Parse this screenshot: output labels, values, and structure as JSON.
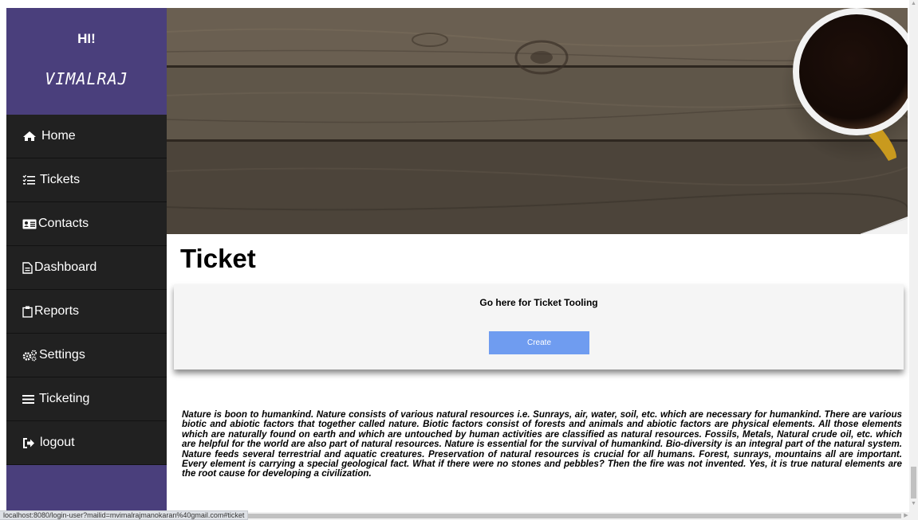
{
  "sidebar": {
    "greeting": "HI!",
    "user_name": "VIMALRAJ",
    "items": [
      {
        "label": "Home",
        "icon": "home-icon"
      },
      {
        "label": "Tickets",
        "icon": "list-check-icon"
      },
      {
        "label": "Contacts",
        "icon": "address-card-icon"
      },
      {
        "label": "Dashboard",
        "icon": "file-icon"
      },
      {
        "label": "Reports",
        "icon": "clipboard-icon"
      },
      {
        "label": "Settings",
        "icon": "gears-icon"
      },
      {
        "label": "Ticketing",
        "icon": "bars-icon"
      },
      {
        "label": "logout",
        "icon": "sign-out-icon"
      }
    ]
  },
  "main": {
    "title": "Ticket",
    "card": {
      "heading": "Go here for Ticket Tooling",
      "button_label": "Create"
    },
    "paragraph": "Nature is boon to humankind. Nature consists of various natural resources i.e. Sunrays, air, water, soil, etc. which are necessary for humankind. There are various biotic and abiotic factors that together called nature. Biotic factors consist of forests and animals and abiotic factors are physical elements. All those elements which are naturally found on earth and which are untouched by human activities are classified as natural resources. Fossils, Metals, Natural crude oil, etc. which are helpful for the world are also part of natural resources. Nature is essential for the survival of humankind. Bio-diversity is an integral part of the natural system. Nature feeds several terrestrial and aquatic creatures. Preservation of natural resources is crucial for all humans. Forest, sunrays, mountains all are important. Every element is carrying a special geological fact. What if there were no stones and pebbles? Then the fire was not invented. Yes, it is true natural elements are the root cause for developing a civilization."
  },
  "status_bar": {
    "url": "localhost:8080/login-user?mailid=mvimalrajmanokaran%40gmail.com#ticket"
  },
  "colors": {
    "sidebar_header": "#4a3f7c",
    "nav_background": "#212121",
    "button": "#6f9cf0",
    "card_background": "#f5f5f5"
  }
}
